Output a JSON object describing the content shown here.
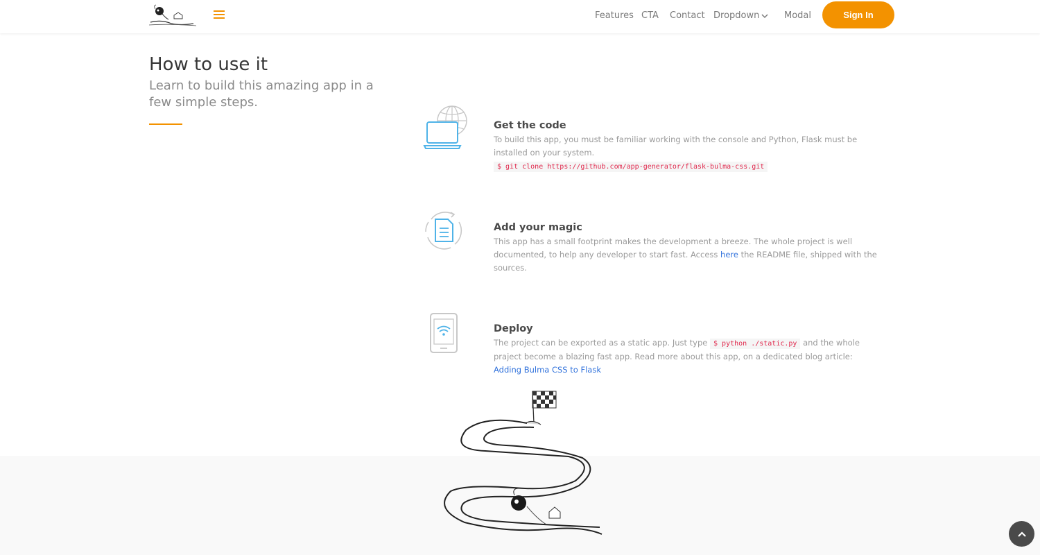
{
  "nav": {
    "items": [
      "Features",
      "CTA",
      "Contact",
      "Dropdown",
      "Modal"
    ],
    "signin_label": "Sign In",
    "accent_color": "#f39200"
  },
  "section": {
    "title": "How to use it",
    "subtitle": "Learn to build this amazing app in a few simple steps."
  },
  "steps": [
    {
      "icon": "laptop-globe-icon",
      "title": "Get the code",
      "text": "To build this app, you must be familiar working with the console and Python, Flask must be installed on your system.",
      "code": "$ git clone https://github.com/app-generator/flask-bulma-css.git"
    },
    {
      "icon": "document-refresh-icon",
      "title": "Add your magic",
      "text_before": "This app has a small footprint makes the development a breeze. The whole project is well documented, to help any developer to start fast. Access",
      "link": "here",
      "text_after": "the README file, shipped with the sources."
    },
    {
      "icon": "tablet-wifi-icon",
      "title": "Deploy",
      "text_before": "The project can be exported as a static app. Just type",
      "code": "$ python ./static.py",
      "text_after": "and the whole praject become a blazing fast app. Read more about this app, on a dedicated blog article:",
      "link": "Adding Bulma CSS to Flask"
    }
  ]
}
